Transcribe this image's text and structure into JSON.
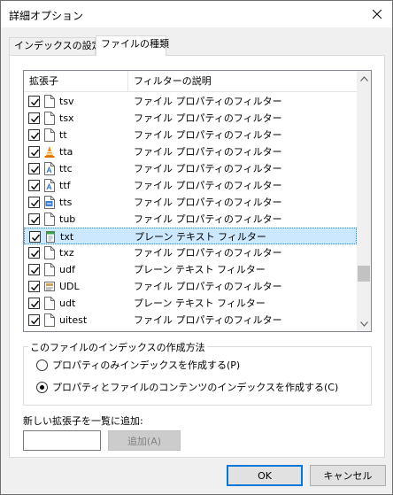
{
  "window": {
    "title": "詳細オプション"
  },
  "tabs": [
    {
      "label": "インデックスの設定",
      "active": false
    },
    {
      "label": "ファイルの種類",
      "active": true
    }
  ],
  "list": {
    "columns": [
      "拡張子",
      "フィルターの説明"
    ],
    "rows": [
      {
        "ext": "tsv",
        "desc": "ファイル プロパティのフィルター",
        "checked": true,
        "icon": "blank-file-icon"
      },
      {
        "ext": "tsx",
        "desc": "ファイル プロパティのフィルター",
        "checked": true,
        "icon": "blank-file-icon"
      },
      {
        "ext": "tt",
        "desc": "ファイル プロパティのフィルター",
        "checked": true,
        "icon": "blank-file-icon"
      },
      {
        "ext": "tta",
        "desc": "ファイル プロパティのフィルター",
        "checked": true,
        "icon": "vlc-cone-icon"
      },
      {
        "ext": "ttc",
        "desc": "ファイル プロパティのフィルター",
        "checked": true,
        "icon": "font-file-icon"
      },
      {
        "ext": "ttf",
        "desc": "ファイル プロパティのフィルター",
        "checked": true,
        "icon": "font-file-icon"
      },
      {
        "ext": "tts",
        "desc": "ファイル プロパティのフィルター",
        "checked": true,
        "icon": "media-file-icon"
      },
      {
        "ext": "tub",
        "desc": "ファイル プロパティのフィルター",
        "checked": true,
        "icon": "blank-file-icon"
      },
      {
        "ext": "txt",
        "desc": "プレーン テキスト フィルター",
        "checked": true,
        "icon": "notepad-file-icon",
        "selected": true
      },
      {
        "ext": "txz",
        "desc": "ファイル プロパティのフィルター",
        "checked": true,
        "icon": "blank-file-icon"
      },
      {
        "ext": "udf",
        "desc": "プレーン テキスト フィルター",
        "checked": true,
        "icon": "blank-file-icon"
      },
      {
        "ext": "UDL",
        "desc": "ファイル プロパティのフィルター",
        "checked": true,
        "icon": "udl-file-icon"
      },
      {
        "ext": "udt",
        "desc": "プレーン テキスト フィルター",
        "checked": true,
        "icon": "blank-file-icon"
      },
      {
        "ext": "uitest",
        "desc": "ファイル プロパティのフィルター",
        "checked": true,
        "icon": "blank-file-icon"
      }
    ]
  },
  "index_method": {
    "legend": "このファイルのインデックスの作成方法",
    "options": [
      {
        "label": "プロパティのみインデックスを作成する(P)",
        "selected": false
      },
      {
        "label": "プロパティとファイルのコンテンツのインデックスを作成する(C)",
        "selected": true
      }
    ]
  },
  "add_extension": {
    "label": "新しい拡張子を一覧に追加:",
    "value": "",
    "button": "追加(A)"
  },
  "footer": {
    "ok": "OK",
    "cancel": "キャンセル"
  },
  "colors": {
    "accent": "#0078d7",
    "selection": "#cce8ff"
  }
}
